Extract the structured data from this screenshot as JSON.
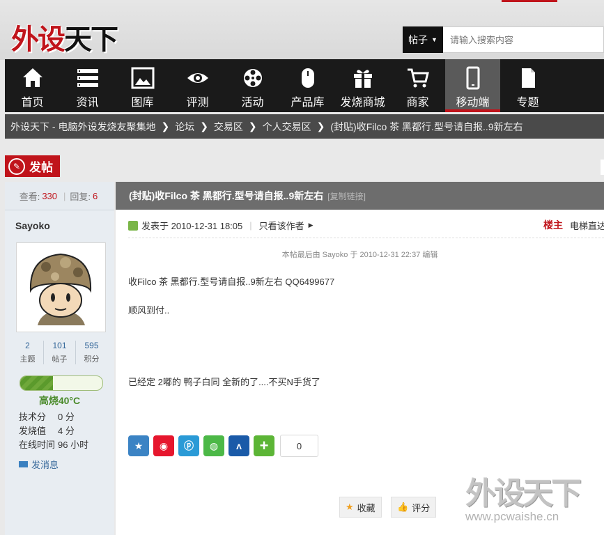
{
  "site": {
    "logo_red": "外设",
    "logo_black": "天下"
  },
  "search": {
    "type_label": "帖子",
    "placeholder": "请输入搜索内容"
  },
  "nav": {
    "items": [
      {
        "label": "首页",
        "icon": "home-icon"
      },
      {
        "label": "资讯",
        "icon": "list-icon"
      },
      {
        "label": "图库",
        "icon": "image-icon"
      },
      {
        "label": "评测",
        "icon": "eye-icon"
      },
      {
        "label": "活动",
        "icon": "film-reel-icon"
      },
      {
        "label": "产品库",
        "icon": "mouse-icon"
      },
      {
        "label": "发烧商城",
        "icon": "gift-icon"
      },
      {
        "label": "商家",
        "icon": "cart-icon"
      },
      {
        "label": "移动端",
        "icon": "phone-icon"
      },
      {
        "label": "专题",
        "icon": "document-icon"
      }
    ],
    "active_index": 8
  },
  "breadcrumb": [
    "外设天下 - 电脑外设发烧友聚集地",
    "论坛",
    "交易区",
    "个人交易区",
    "(封贴)收Filco 茶 黑都行.型号请自报..9新左右"
  ],
  "post_button": "发帖",
  "sidebar": {
    "views_label": "查看:",
    "views": "330",
    "replies_label": "回复:",
    "replies": "6",
    "username": "Sayoko",
    "counts": [
      {
        "value": "2",
        "label": "主题"
      },
      {
        "value": "101",
        "label": "帖子"
      },
      {
        "value": "595",
        "label": "积分"
      }
    ],
    "level_progress": 0.4,
    "level_name": "高烧40°C",
    "info": [
      {
        "label": "技术分",
        "value": "0 分"
      },
      {
        "label": "发烧值",
        "value": "4 分"
      },
      {
        "label": "在线时间",
        "value": "96 小时"
      }
    ],
    "message_label": "发消息"
  },
  "thread": {
    "title": "(封贴)收Filco 茶 黑都行.型号请自报..9新左右",
    "copy_link": "[复制链接]",
    "posted_at": "发表于 2010-12-31 18:05",
    "only_author": "只看该作者",
    "floor": "楼主",
    "elevator": "电梯直达",
    "edited_note": "本帖最后由 Sayoko 于 2010-12-31 22:37 编辑",
    "lines": [
      "收Filco 茶 黑都行.型号请自报..9新左右  QQ6499677",
      "顺风到付..",
      "已经定 2嘟的 鸭子白同 全新的了....不买N手货了"
    ],
    "like_count": "0",
    "favorite_label": "收藏",
    "rate_label": "评分"
  },
  "share_icons": [
    "qzone-icon",
    "weibo-icon",
    "pengyou-icon",
    "wechat-icon",
    "renren-icon",
    "more-share-icon"
  ],
  "share_colors": [
    "#3b83c4",
    "#e6162d",
    "#2a9ad6",
    "#4cb847",
    "#1a5aa8",
    "#5cb536"
  ],
  "watermark": {
    "text": "外设天下",
    "url": "www.pcwaishe.cn"
  }
}
